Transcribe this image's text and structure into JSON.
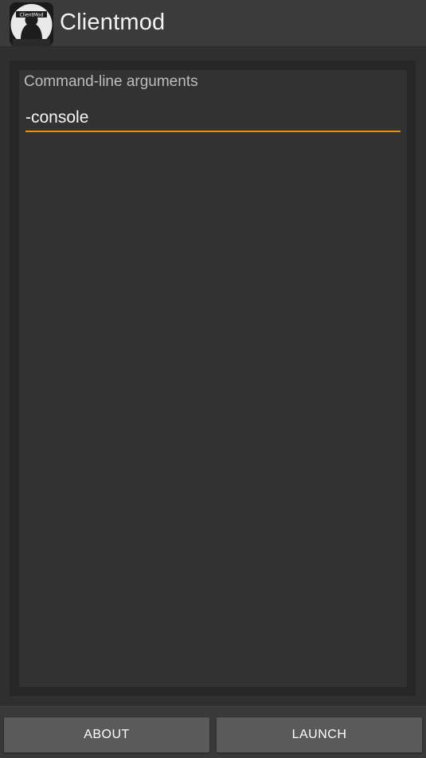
{
  "app": {
    "title": "Clientmod",
    "icon": "clientmod-logo-icon",
    "icon_text": "ClientMod"
  },
  "form": {
    "args_label": "Command-line arguments",
    "args_value": "-console"
  },
  "buttons": {
    "about": "ABOUT",
    "launch": "LAUNCH"
  },
  "colors": {
    "accent": "#e8900f",
    "button_bg": "#5a5a5a",
    "background": "#303030"
  }
}
